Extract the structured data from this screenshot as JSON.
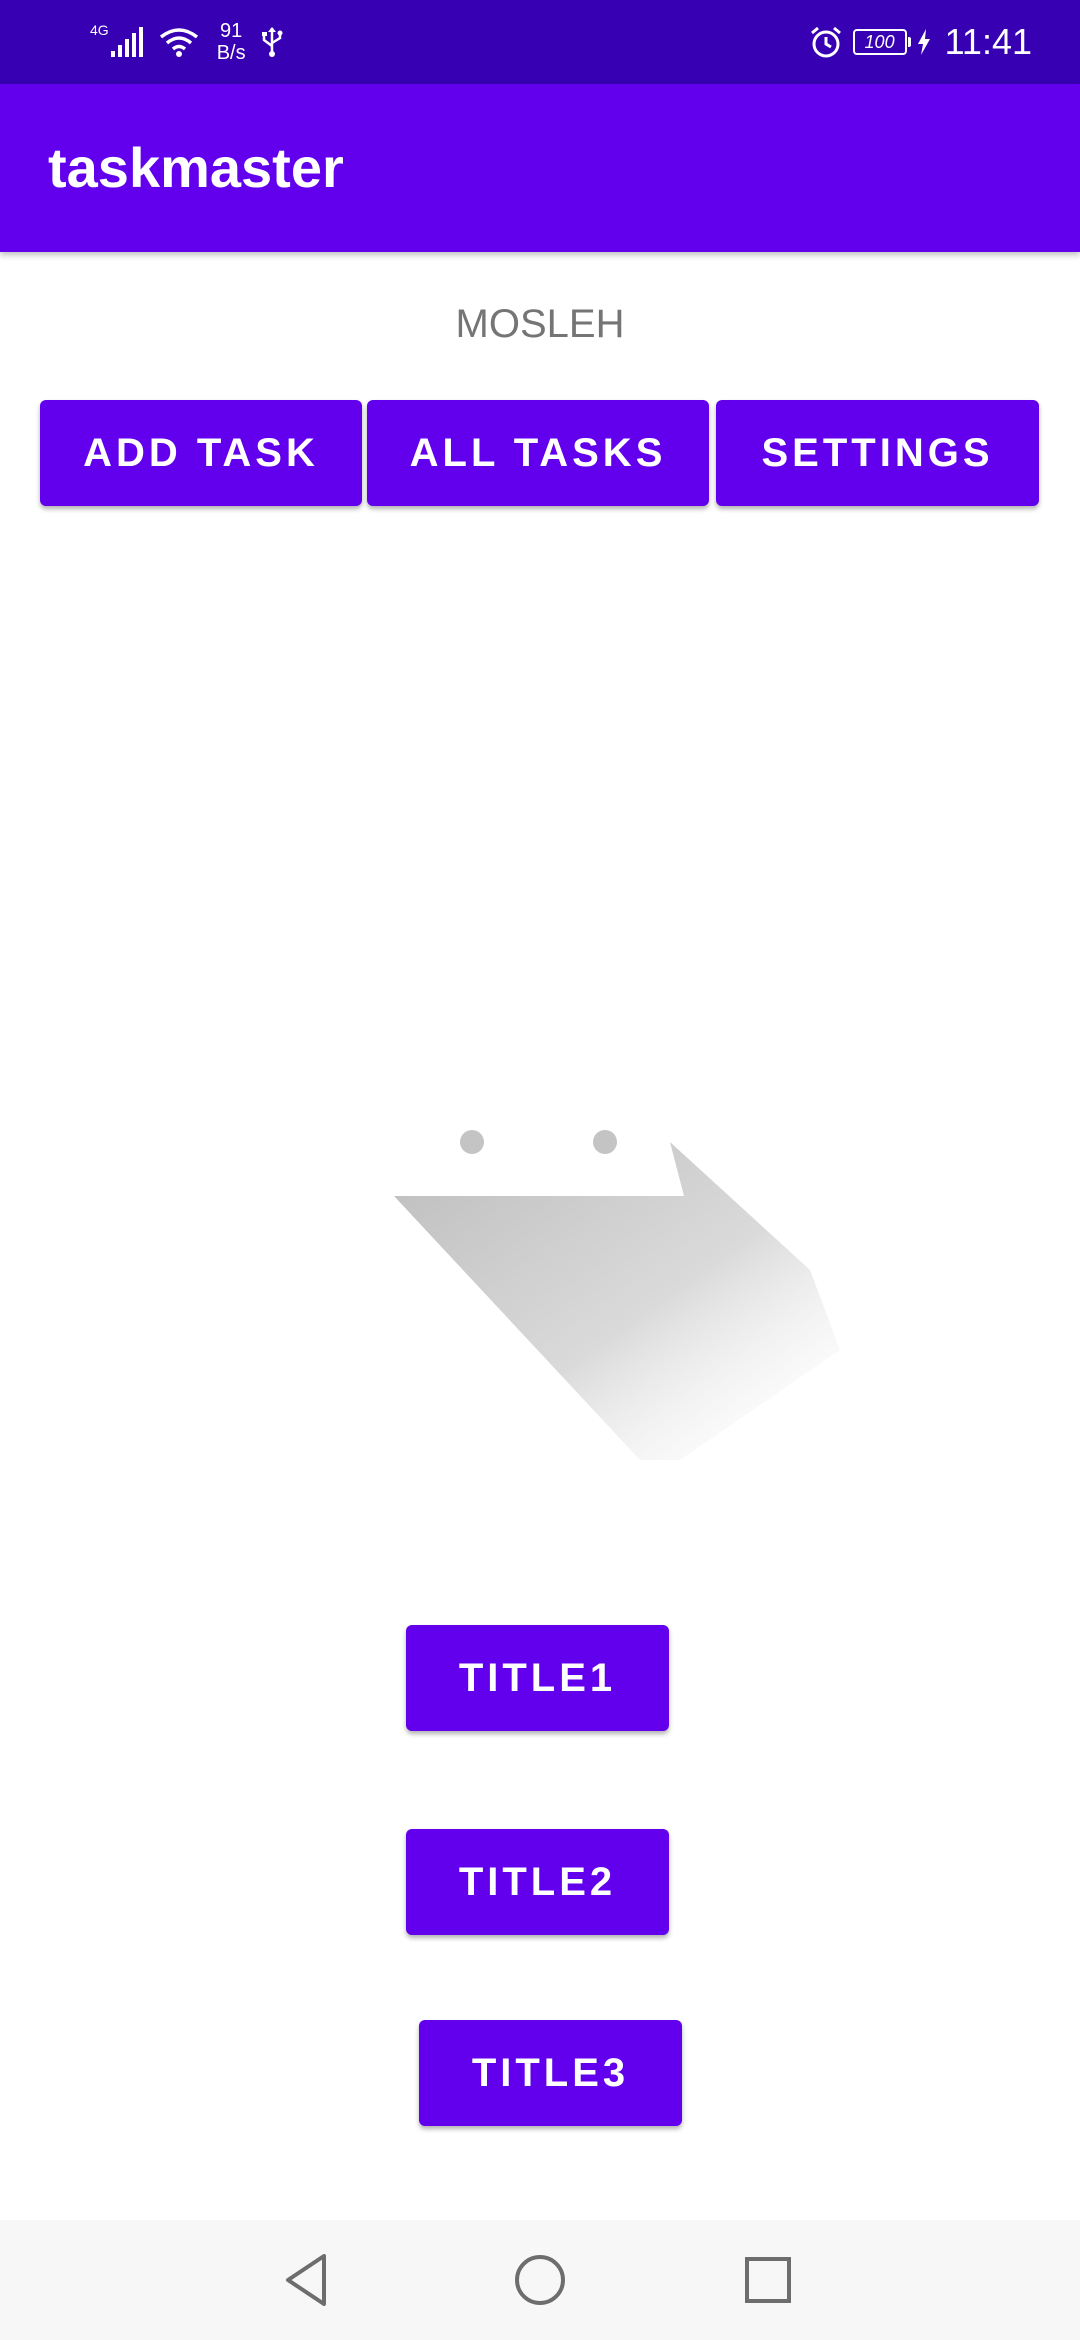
{
  "status_bar": {
    "network_type": "4G",
    "speed_value": "91",
    "speed_unit": "B/s",
    "battery": "100",
    "time": "11:41",
    "icons": [
      "signal-icon",
      "wifi-icon",
      "usb-icon",
      "alarm-icon",
      "battery-icon",
      "charging-icon"
    ]
  },
  "app_bar": {
    "title": "taskmaster"
  },
  "main": {
    "username": "MOSLEH",
    "buttons": {
      "add_task": "ADD TASK",
      "all_tasks": "ALL TASKS",
      "settings": "SETTINGS"
    },
    "task_buttons": [
      "TITLE1",
      "TITLE2",
      "TITLE3"
    ]
  },
  "nav_bar": {
    "icons": [
      "back-icon",
      "home-icon",
      "recents-icon"
    ]
  },
  "colors": {
    "primary": "#6200EE",
    "primary_dark": "#3700B3",
    "username_text": "#757575",
    "button_text": "#FFFFFF"
  }
}
